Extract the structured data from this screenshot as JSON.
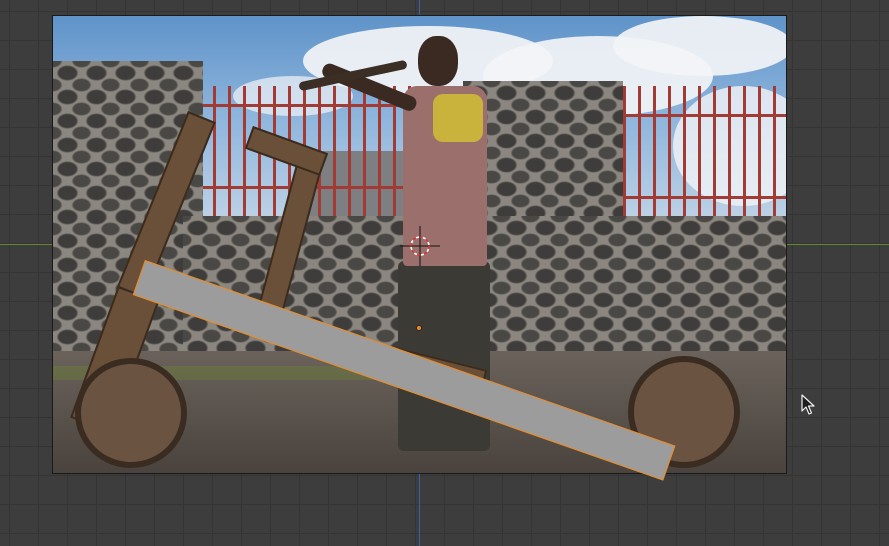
{
  "viewport": {
    "colors": {
      "background": "#3d3d3d",
      "grid_line": "#343434",
      "x_axis": "#5f8b2e",
      "y_axis": "#3a62a6",
      "selection_outline": "#f08a1c",
      "selected_plane_fill": "#9c9c9c"
    }
  },
  "objects": {
    "reference_image": {
      "icon": "photo-plane"
    },
    "selected_plane": {
      "icon": "mesh-plane",
      "selected": true
    },
    "origin": {
      "icon": "origin-dot-icon"
    },
    "cursor_3d": {
      "icon": "3d-cursor-icon"
    },
    "mouse_pointer": {
      "icon": "arrow-pointer-icon"
    }
  }
}
